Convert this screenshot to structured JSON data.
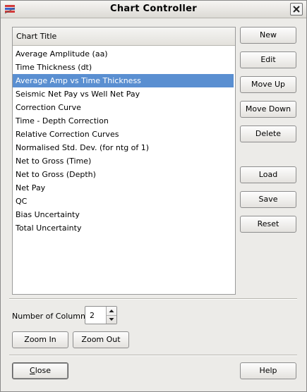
{
  "window": {
    "title": "Chart Controller"
  },
  "list": {
    "header": "Chart Title",
    "items": [
      "Average Amplitude (aa)",
      "Time Thickness (dt)",
      "Average Amp vs Time Thickness",
      "Seismic Net Pay vs Well Net Pay",
      "Correction Curve",
      "Time - Depth Correction",
      "Relative Correction Curves",
      "Normalised Std. Dev. (for ntg of 1)",
      "Net to Gross (Time)",
      "Net to Gross (Depth)",
      "Net Pay",
      "QC",
      "Bias Uncertainty",
      "Total Uncertainty"
    ],
    "selected_item": "Average Amp vs Time Thickness"
  },
  "side_buttons": {
    "new": "New",
    "edit": "Edit",
    "move_up": "Move Up",
    "move_down": "Move Down",
    "delete": "Delete",
    "load": "Load",
    "save": "Save",
    "reset": "Reset"
  },
  "columns": {
    "label": "Number of Columns",
    "value": "2"
  },
  "zoom": {
    "zoom_in": "Zoom In",
    "zoom_out": "Zoom Out"
  },
  "footer": {
    "close_first_letter": "C",
    "close_rest": "lose",
    "help": "Help"
  },
  "colors": {
    "selection": "#5a8fd1",
    "background": "#ecebe8"
  }
}
